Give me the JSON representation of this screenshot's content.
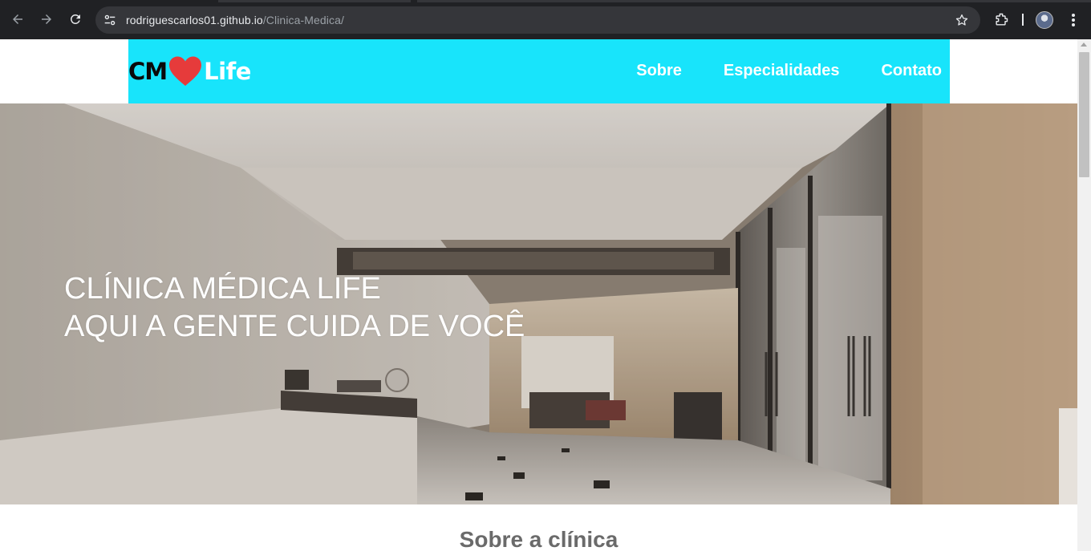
{
  "browser": {
    "url_host": "rodriguescarlos01.github.io",
    "url_path": "/Clinica-Medica/"
  },
  "site": {
    "logo": {
      "left_text": "CM",
      "right_text": "Life"
    },
    "nav": [
      {
        "label": "Sobre"
      },
      {
        "label": "Especialidades"
      },
      {
        "label": "Contato"
      }
    ],
    "hero": {
      "line1": "CLÍNICA MÉDICA LIFE",
      "line2": "AQUI A GENTE CUIDA DE VOCÊ"
    },
    "about": {
      "title": "Sobre a clínica"
    }
  },
  "colors": {
    "header_bg": "#18e4fb",
    "heart": "#e63b3b",
    "chrome_bg": "#202124"
  }
}
